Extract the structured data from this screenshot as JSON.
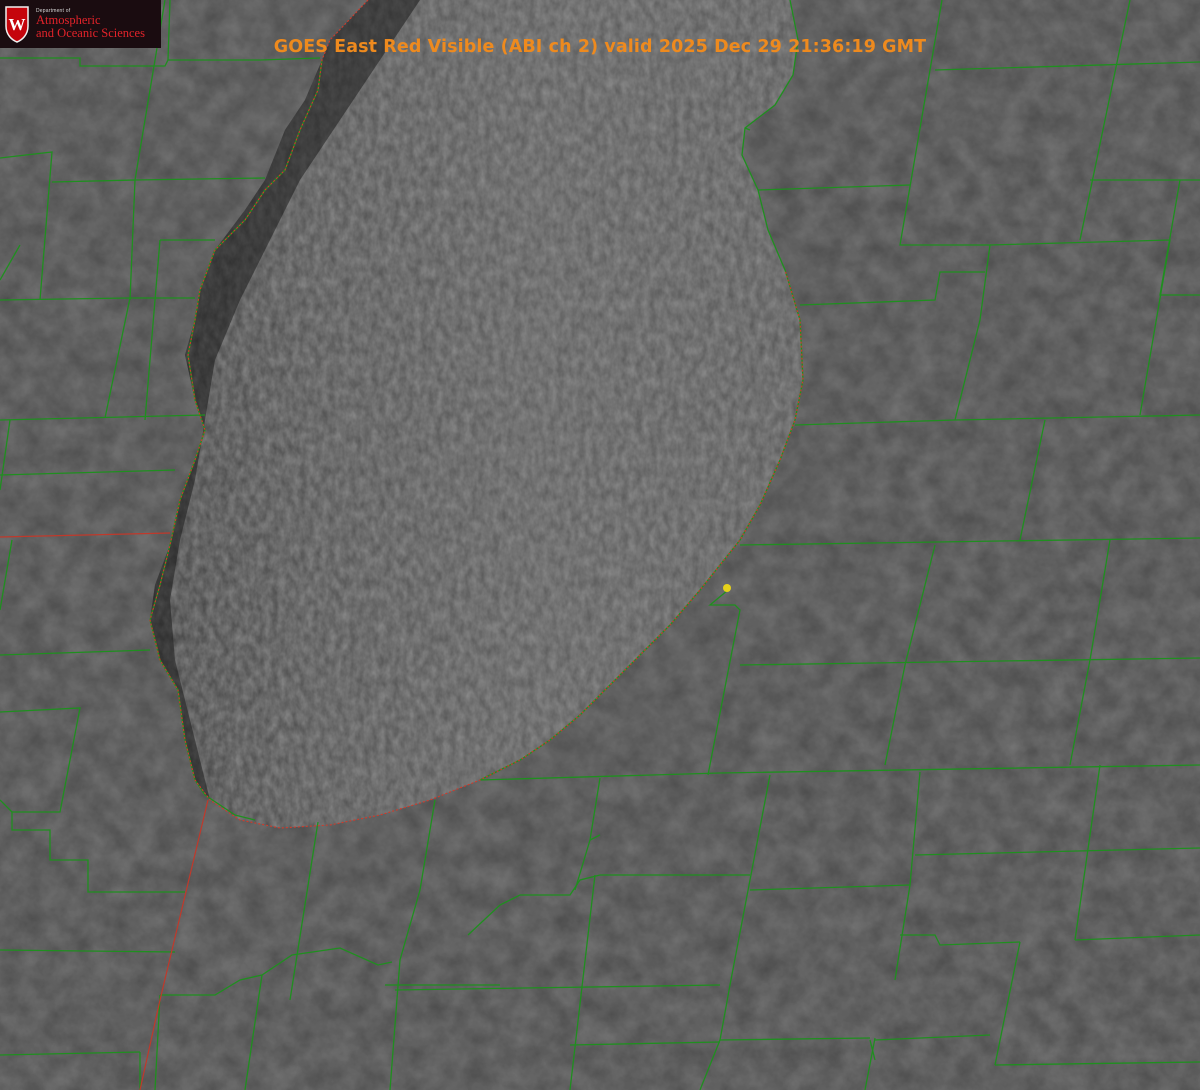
{
  "title": "GOES East Red Visible (ABI ch 2) valid 2025 Dec 29 21:36:19 GMT",
  "logo": {
    "line1": "Department of",
    "line2": "Atmospheric",
    "line3": "and Oceanic Sciences",
    "crest_letter": "W"
  },
  "colors": {
    "background_land": "#3a3a3a",
    "lake_surface": "#4b4b4b",
    "county_lines": "#1f8f1f",
    "state_lines": "#d23a2a",
    "marker": "#e6d21a",
    "title_text": "#ee8a1e",
    "logo_bg": "#1a0c10",
    "logo_text": "#e2232a"
  },
  "icons": {
    "crest": "uw-crest-icon",
    "marker": "station-dot-icon"
  }
}
